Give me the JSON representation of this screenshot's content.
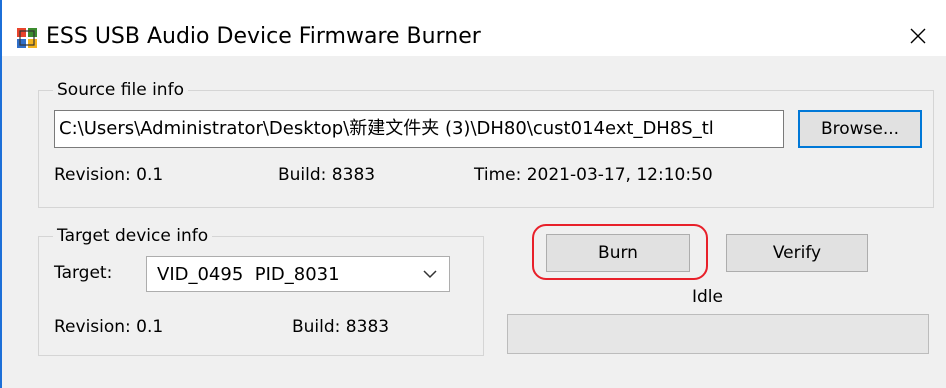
{
  "window": {
    "title": "ESS USB Audio Device Firmware Burner",
    "icon": "chip-app-icon",
    "close_glyph": "✕"
  },
  "source": {
    "group_label": "Source file info",
    "path": "C:\\Users\\Administrator\\Desktop\\新建文件夹 (3)\\DH80\\cust014ext_DH8S_tl",
    "browse_label": "Browse...",
    "revision": "Revision: 0.1",
    "build": "Build:  8383",
    "time": "Time:  2021-03-17, 12:10:50"
  },
  "target": {
    "group_label": "Target device info",
    "target_label": "Target:",
    "selected": "VID_0495  PID_8031",
    "revision": "Revision: 0.1",
    "build": "Build:  8383"
  },
  "actions": {
    "burn_label": "Burn",
    "verify_label": "Verify"
  },
  "status": {
    "text": "Idle",
    "progress": 0
  },
  "colors": {
    "accent": "#0078d7",
    "highlight": "#e8202a",
    "window_border": "#1c6fd8"
  }
}
